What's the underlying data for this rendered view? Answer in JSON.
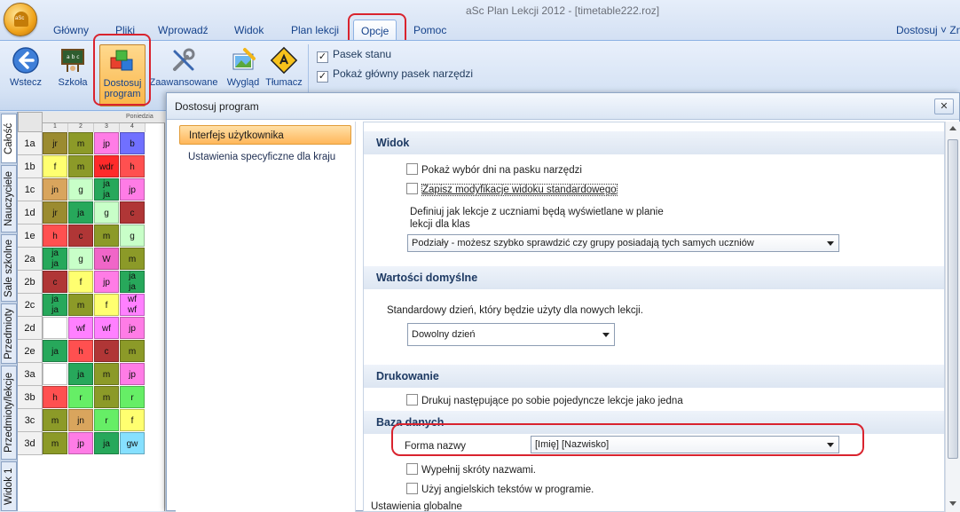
{
  "window": {
    "title": "aSc Plan Lekcji 2012 - [timetable222.roz]",
    "customize_menu": "Dostosuj ˅ Zn"
  },
  "ribbon_tabs": [
    {
      "label": "Główny"
    },
    {
      "label": "Pliki"
    },
    {
      "label": "Wprowadź"
    },
    {
      "label": "Widok"
    },
    {
      "label": "Plan lekcji"
    },
    {
      "label": "Opcje"
    },
    {
      "label": "Pomoc"
    }
  ],
  "ribbon_buttons": [
    {
      "label": "Wstecz",
      "icon": "back-arrow-icon"
    },
    {
      "label": "Szkoła",
      "icon": "school-blackboard-icon"
    },
    {
      "label": "Dostosuj program",
      "label1": "Dostosuj",
      "label2": "program",
      "icon": "customize-cubes-icon"
    },
    {
      "label": "Zaawansowane",
      "icon": "tools-wrench-icon"
    },
    {
      "label": "Wygląd",
      "icon": "appearance-palette-icon"
    },
    {
      "label": "Tłumacz",
      "icon": "translate-sign-icon"
    }
  ],
  "ribbon_checks": [
    {
      "label": "Pasek stanu",
      "checked": true
    },
    {
      "label": "Pokaż główny pasek narzędzi",
      "checked": true
    }
  ],
  "side_tabs": [
    "Całość",
    "Nauczyciele",
    "Sale szkolne",
    "Przedmioty",
    "Przedmioty/lekcje",
    "Widok 1"
  ],
  "grid": {
    "day_header": "Poniedzia",
    "periods": [
      "1",
      "2",
      "3",
      "4"
    ],
    "rows": [
      {
        "label": "1a",
        "cells": [
          [
            "jr"
          ],
          [
            "m"
          ],
          [
            "jp"
          ],
          [
            "b"
          ]
        ]
      },
      {
        "label": "1b",
        "cells": [
          [
            "f"
          ],
          [
            "m"
          ],
          [
            "wdr"
          ],
          [
            "h"
          ]
        ]
      },
      {
        "label": "1c",
        "cells": [
          [
            "jn"
          ],
          [
            "g"
          ],
          [
            "ja",
            "ja"
          ],
          [
            "jp"
          ]
        ]
      },
      {
        "label": "1d",
        "cells": [
          [
            "jr"
          ],
          [
            "ja"
          ],
          [
            "g"
          ],
          [
            "c"
          ]
        ]
      },
      {
        "label": "1e",
        "cells": [
          [
            "h"
          ],
          [
            "c"
          ],
          [
            "m"
          ],
          [
            "g"
          ]
        ]
      },
      {
        "label": "2a",
        "cells": [
          [
            "ja",
            "ja"
          ],
          [
            "g"
          ],
          [
            "W"
          ],
          [
            "m"
          ]
        ]
      },
      {
        "label": "2b",
        "cells": [
          [
            "c"
          ],
          [
            "f"
          ],
          [
            "jp"
          ],
          [
            "ja",
            "ja"
          ]
        ]
      },
      {
        "label": "2c",
        "cells": [
          [
            "ja",
            "ja"
          ],
          [
            "m"
          ],
          [
            "f"
          ],
          [
            "wf",
            "wf"
          ]
        ]
      },
      {
        "label": "2d",
        "cells": [
          [
            ""
          ],
          [
            "wf"
          ],
          [
            "wf"
          ],
          [
            "jp"
          ]
        ]
      },
      {
        "label": "2e",
        "cells": [
          [
            "ja"
          ],
          [
            "h"
          ],
          [
            "c"
          ],
          [
            "m"
          ]
        ]
      },
      {
        "label": "3a",
        "cells": [
          [
            ""
          ],
          [
            "ja"
          ],
          [
            "m"
          ],
          [
            "jp"
          ]
        ]
      },
      {
        "label": "3b",
        "cells": [
          [
            "h"
          ],
          [
            "r"
          ],
          [
            "m"
          ],
          [
            "r"
          ]
        ]
      },
      {
        "label": "3c",
        "cells": [
          [
            "m"
          ],
          [
            "jn"
          ],
          [
            "r"
          ],
          [
            "f"
          ]
        ]
      },
      {
        "label": "3d",
        "cells": [
          [
            "m"
          ],
          [
            "jp"
          ],
          [
            "ja"
          ],
          [
            "gw"
          ]
        ]
      }
    ]
  },
  "dialog": {
    "title": "Dostosuj program",
    "close_icon": "close-x-icon",
    "nav": [
      {
        "label": "Interfejs użytkownika",
        "active": true
      },
      {
        "label": "Ustawienia specyficzne dla kraju",
        "active": false
      }
    ],
    "sections": {
      "widok": {
        "header": "Widok",
        "opt_days": "Pokaż wybór dni na pasku narzędzi",
        "opt_save_view": "Zapisz modyfikacje widoku standardowego",
        "desc_line1": "Definiuj jak lekcje z uczniami będą wyświetlane w planie",
        "desc_line2": "lekcji dla klas",
        "combo_value": "Podziały - możesz szybko sprawdzić czy grupy posiadają tych samych uczniów"
      },
      "domyslne": {
        "header": "Wartości domyślne",
        "label": "Standardowy dzień, który będzie użyty dla nowych lekcji.",
        "combo_value": "Dowolny dzień"
      },
      "drukowanie": {
        "header": "Drukowanie",
        "opt_print": "Drukuj następujące po sobie pojedyncze lekcje jako jedna"
      },
      "baza": {
        "header": "Baza danych",
        "name_label": "Forma nazwy",
        "name_value": "[Imię] [Nazwisko]",
        "opt_fill": "Wypełnij skróty nazwami.",
        "opt_english": "Użyj angielskich tekstów w programie.",
        "global": "Ustawienia globalne"
      }
    }
  },
  "colors": {
    "highlight_ring": "#d9232e",
    "ribbon_text": "#15428b",
    "active_nav": "#ffb75a"
  }
}
